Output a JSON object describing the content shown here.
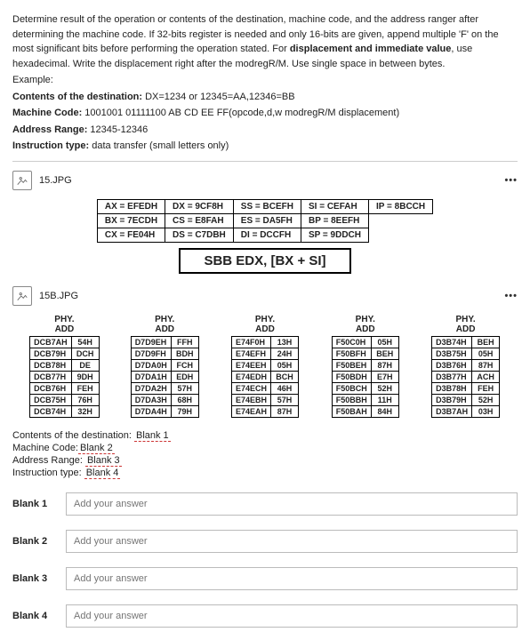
{
  "intro": {
    "p1": "Determine result of the operation or contents of the destination, machine code, and the address ranger after determining the machine code. If 32-bits register is needed and only 16-bits are given, append multiple 'F' on the most significant bits before performing the operation stated. For ",
    "b1": "displacement and immediate value",
    "p2": ", use hexadecimal. Write the displacement right after the modregR/M.  Use single space in between bytes.",
    "example_label": "Example:",
    "l_contents_lbl": "Contents of the destination:",
    "l_contents_val": " DX=1234 or 12345=AA,12346=BB",
    "l_mcode_lbl": "Machine Code:",
    "l_mcode_val": " 1001001 01111100 AB CD EE FF(opcode,d,w modregR/M displacement)",
    "l_range_lbl": "Address Range:",
    "l_range_val": " 12345-12346",
    "l_type_lbl": "Instruction type:",
    "l_type_val": " data transfer (small letters only)"
  },
  "files": {
    "a": "15.JPG",
    "b": "15B.JPG"
  },
  "regs": {
    "r": [
      [
        "AX = EFEDH",
        "DX = 9CF8H",
        "SS = BCEFH",
        "SI = CEFAH",
        "IP = 8BCCH"
      ],
      [
        "BX = 7ECDH",
        "CS = E8FAH",
        "ES = DA5FH",
        "BP = 8EEFH",
        ""
      ],
      [
        "CX = FE04H",
        "DS = C7DBH",
        "DI = DCCFH",
        "SP = 9DDCH",
        ""
      ]
    ]
  },
  "opcode": "SBB EDX, [BX + SI]",
  "mem": {
    "head1": "PHY.",
    "head2": "ADD",
    "cols": [
      [
        [
          "DCB7AH",
          "54H"
        ],
        [
          "DCB79H",
          "DCH"
        ],
        [
          "DCB78H",
          "DE"
        ],
        [
          "DCB77H",
          "9DH"
        ],
        [
          "DCB76H",
          "FEH"
        ],
        [
          "DCB75H",
          "76H"
        ],
        [
          "DCB74H",
          "32H"
        ]
      ],
      [
        [
          "D7D9EH",
          "FFH"
        ],
        [
          "D7D9FH",
          "BDH"
        ],
        [
          "D7DA0H",
          "FCH"
        ],
        [
          "D7DA1H",
          "EDH"
        ],
        [
          "D7DA2H",
          "57H"
        ],
        [
          "D7DA3H",
          "68H"
        ],
        [
          "D7DA4H",
          "79H"
        ]
      ],
      [
        [
          "E74F0H",
          "13H"
        ],
        [
          "E74EFH",
          "24H"
        ],
        [
          "E74EEH",
          "05H"
        ],
        [
          "E74EDH",
          "BCH"
        ],
        [
          "E74ECH",
          "46H"
        ],
        [
          "E74EBH",
          "57H"
        ],
        [
          "E74EAH",
          "87H"
        ]
      ],
      [
        [
          "F50C0H",
          "05H"
        ],
        [
          "F50BFH",
          "BEH"
        ],
        [
          "F50BEH",
          "87H"
        ],
        [
          "F50BDH",
          "E7H"
        ],
        [
          "F50BCH",
          "52H"
        ],
        [
          "F50BBH",
          "11H"
        ],
        [
          "F50BAH",
          "84H"
        ]
      ],
      [
        [
          "D3B74H",
          "BEH"
        ],
        [
          "D3B75H",
          "05H"
        ],
        [
          "D3B76H",
          "87H"
        ],
        [
          "D3B77H",
          "ACH"
        ],
        [
          "D3B78H",
          "FEH"
        ],
        [
          "D3B79H",
          "52H"
        ],
        [
          "D3B7AH",
          "03H"
        ]
      ]
    ]
  },
  "answers": {
    "l1_a": "Contents of the destination: ",
    "l1_b": "Blank 1",
    "l2_a": "Machine Code:",
    "l2_b": "Blank 2",
    "l3_a": "Address Range: ",
    "l3_b": "Blank 3",
    "l4_a": "Instruction type: ",
    "l4_b": "Blank 4"
  },
  "blanks": {
    "b1": "Blank 1",
    "b2": "Blank 2",
    "b3": "Blank 3",
    "b4": "Blank 4",
    "ph": "Add your answer"
  },
  "chart_data": {
    "type": "table",
    "registers": {
      "AX": "EFEDH",
      "DX": "9CF8H",
      "SS": "BCEFH",
      "SI": "CEFAH",
      "IP": "8BCCH",
      "BX": "7ECDH",
      "CS": "E8FAH",
      "ES": "DA5FH",
      "BP": "8EEFH",
      "CX": "FE04H",
      "DS": "C7DBH",
      "DI": "DCCFH",
      "SP": "9DDCH"
    },
    "instruction": "SBB EDX, [BX + SI]",
    "memory_tables": [
      {
        "addresses": [
          "DCB7AH",
          "DCB79H",
          "DCB78H",
          "DCB77H",
          "DCB76H",
          "DCB75H",
          "DCB74H"
        ],
        "values": [
          "54H",
          "DCH",
          "DE",
          "9DH",
          "FEH",
          "76H",
          "32H"
        ]
      },
      {
        "addresses": [
          "D7D9EH",
          "D7D9FH",
          "D7DA0H",
          "D7DA1H",
          "D7DA2H",
          "D7DA3H",
          "D7DA4H"
        ],
        "values": [
          "FFH",
          "BDH",
          "FCH",
          "EDH",
          "57H",
          "68H",
          "79H"
        ]
      },
      {
        "addresses": [
          "E74F0H",
          "E74EFH",
          "E74EEH",
          "E74EDH",
          "E74ECH",
          "E74EBH",
          "E74EAH"
        ],
        "values": [
          "13H",
          "24H",
          "05H",
          "BCH",
          "46H",
          "57H",
          "87H"
        ]
      },
      {
        "addresses": [
          "F50C0H",
          "F50BFH",
          "F50BEH",
          "F50BDH",
          "F50BCH",
          "F50BBH",
          "F50BAH"
        ],
        "values": [
          "05H",
          "BEH",
          "87H",
          "E7H",
          "52H",
          "11H",
          "84H"
        ]
      },
      {
        "addresses": [
          "D3B74H",
          "D3B75H",
          "D3B76H",
          "D3B77H",
          "D3B78H",
          "D3B79H",
          "D3B7AH"
        ],
        "values": [
          "BEH",
          "05H",
          "87H",
          "ACH",
          "FEH",
          "52H",
          "03H"
        ]
      }
    ]
  }
}
